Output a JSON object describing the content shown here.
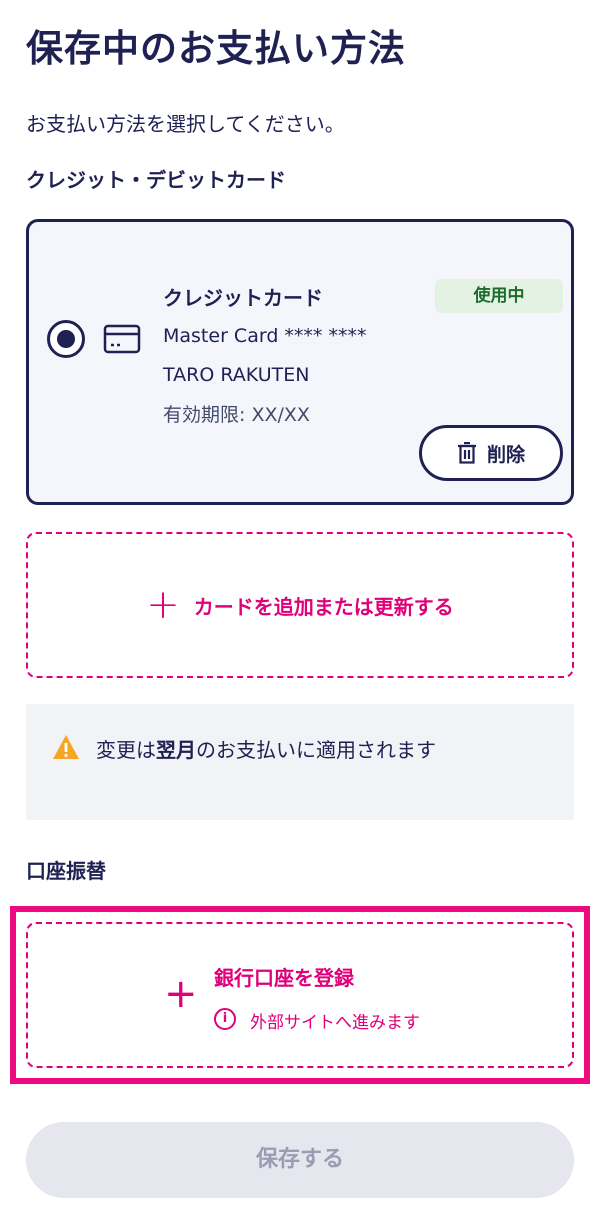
{
  "header": {
    "title": "保存中のお支払い方法",
    "subtitle": "お支払い方法を選択してください。"
  },
  "sections": {
    "card_heading": "クレジット・デビットカード",
    "bank_heading": "口座振替"
  },
  "saved_card": {
    "selected": true,
    "type_label": "クレジットカード",
    "status_badge": "使用中",
    "brand_and_number": "Master Card **** ****",
    "holder_name": "TARO RAKUTEN",
    "expiry": "有効期限: XX/XX",
    "delete_label": "削除",
    "icon": "credit-card-icon"
  },
  "add_card": {
    "label": "カードを追加または更新する",
    "icon": "plus-icon"
  },
  "notice": {
    "icon": "warning-icon",
    "text_before": "変更は",
    "text_bold": "翌月",
    "text_after": "のお支払いに適用されます"
  },
  "add_bank": {
    "label": "銀行口座を登録",
    "note": "外部サイトへ進みます",
    "icon": "plus-icon",
    "info_icon": "info-icon"
  },
  "save_button": {
    "label": "保存する",
    "enabled": false
  },
  "colors": {
    "primary": "#1f2152",
    "accent": "#e0007a",
    "highlight": "#f0087f",
    "badge_bg": "#e3f2e3",
    "badge_text": "#1e6b2e",
    "warning": "#f5a623"
  }
}
